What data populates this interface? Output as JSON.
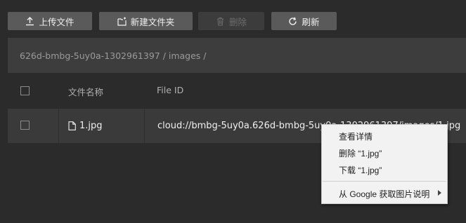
{
  "toolbar": {
    "upload_label": "上传文件",
    "new_folder_label": "新建文件夹",
    "delete_label": "删除",
    "refresh_label": "刷新"
  },
  "breadcrumb": {
    "path": "626d-bmbg-5uy0a-1302961397 / images /"
  },
  "table": {
    "columns": [
      "文件名称",
      "File ID"
    ],
    "rows": [
      {
        "name": "1.jpg",
        "file_id": "cloud://bmbg-5uy0a.626d-bmbg-5uy0a-1302961397/images/1.jpg"
      }
    ]
  },
  "context_menu": {
    "items": [
      "查看详情",
      "删除 “1.jpg”",
      "下载 “1.jpg”",
      "从 Google 获取图片说明"
    ]
  },
  "colors": {
    "background": "#2b2b2b",
    "button": "#5a5a5a",
    "button_disabled": "#3c3c3c",
    "breadcrumb_bar": "#3d3d3d",
    "row": "#3a3a3a",
    "menu": "#f2f2f2"
  }
}
